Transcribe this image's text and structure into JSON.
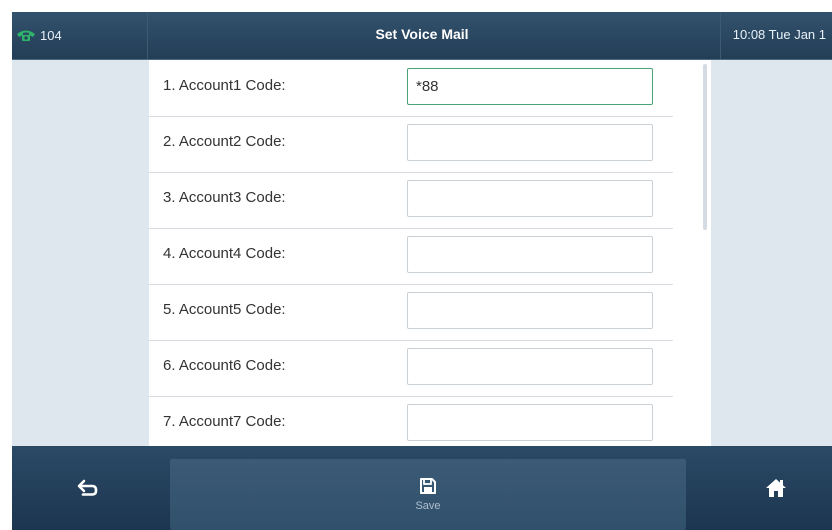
{
  "status": {
    "line_number": "104",
    "title": "Set Voice Mail",
    "clock": "10:08 Tue Jan 1"
  },
  "fields": [
    {
      "label": "1. Account1 Code:",
      "value": "*88"
    },
    {
      "label": "2. Account2 Code:",
      "value": ""
    },
    {
      "label": "3. Account3 Code:",
      "value": ""
    },
    {
      "label": "4. Account4 Code:",
      "value": ""
    },
    {
      "label": "5. Account5 Code:",
      "value": ""
    },
    {
      "label": "6. Account6 Code:",
      "value": ""
    },
    {
      "label": "7. Account7 Code:",
      "value": ""
    }
  ],
  "softkeys": {
    "save_label": "Save"
  },
  "icons": {
    "status": "phone-icon",
    "back": "back-arrow-icon",
    "save": "save-floppy-icon",
    "home": "home-icon"
  },
  "colors": {
    "bar": "#233d55",
    "focus_border": "#4aa376",
    "phone_icon": "#2fb36a"
  }
}
